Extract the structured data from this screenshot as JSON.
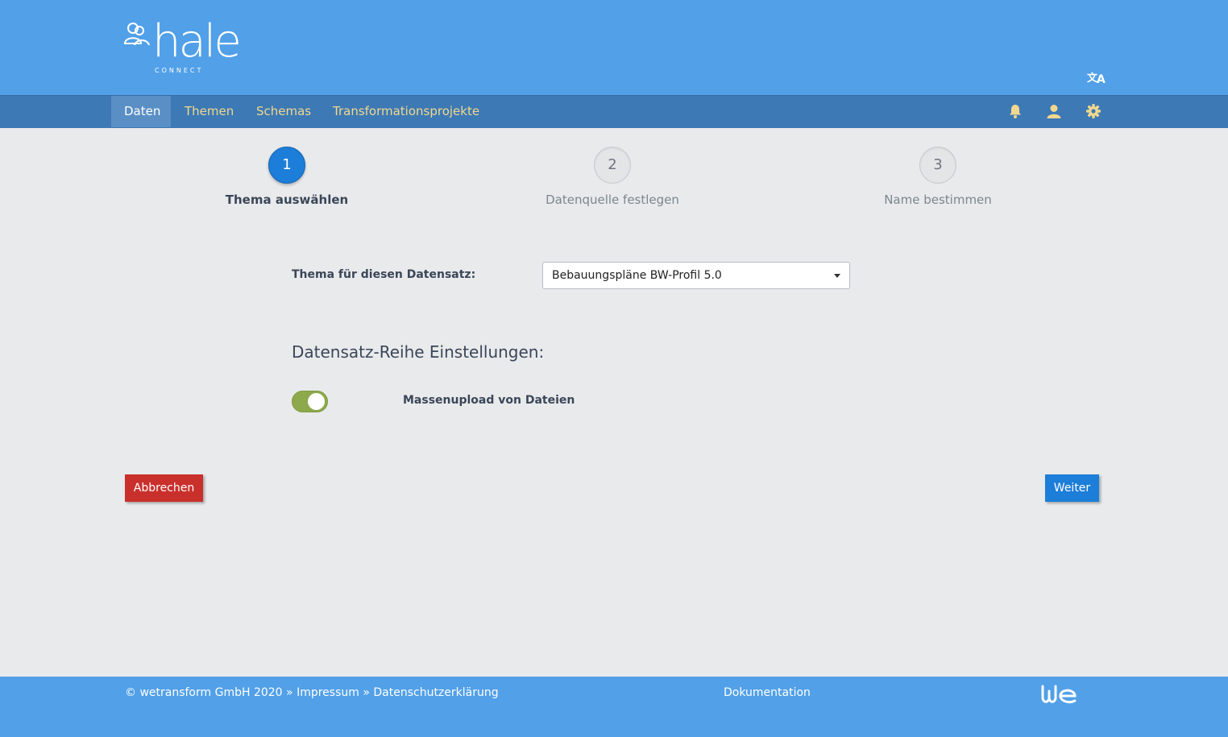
{
  "brand": {
    "name": "hale",
    "subtitle": "CONNECT"
  },
  "nav": {
    "items": [
      {
        "label": "Daten",
        "active": true
      },
      {
        "label": "Themen",
        "active": false
      },
      {
        "label": "Schemas",
        "active": false
      },
      {
        "label": "Transformationsprojekte",
        "active": false
      }
    ],
    "icons": [
      "bell-icon",
      "user-icon",
      "gear-icon"
    ]
  },
  "header": {
    "icons": [
      "translate-icon"
    ]
  },
  "wizard": {
    "steps": [
      {
        "number": "1",
        "label": "Thema auswählen",
        "active": true
      },
      {
        "number": "2",
        "label": "Datenquelle festlegen",
        "active": false
      },
      {
        "number": "3",
        "label": "Name bestimmen",
        "active": false
      }
    ]
  },
  "form": {
    "theme_label": "Thema für diesen Datensatz:",
    "theme_value": "Bebauungspläne BW-Profil 5.0",
    "section_title": "Datensatz-Reihe Einstellungen:",
    "bulk_upload_label": "Massenupload von Dateien",
    "bulk_upload_enabled": true
  },
  "actions": {
    "cancel": "Abbrechen",
    "next": "Weiter"
  },
  "footer": {
    "copyright": "© wetransform GmbH 2020",
    "separator": "»",
    "impressum": "Impressum",
    "privacy": "Datenschutzerklärung",
    "docs": "Dokumentation",
    "logo_text": "we"
  },
  "colors": {
    "header": "#51a0e8",
    "navbar": "#3d79b4",
    "nav_text": "#f2d88e",
    "primary": "#1c7ed8",
    "danger": "#c9302c",
    "toggle_on": "#8da94b",
    "background": "#e9eaec"
  }
}
